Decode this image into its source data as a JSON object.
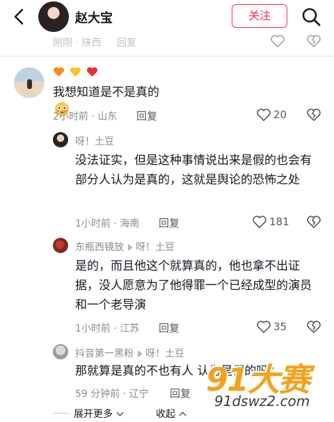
{
  "header": {
    "username": "赵大宝",
    "follow_label": "关注"
  },
  "faded_row": {
    "meta": "刚刚 · 陕西",
    "reply": "回复"
  },
  "comment1": {
    "text": "我想知道是不是真的",
    "emoji_hearts": [
      "orange-heart",
      "yellow-heart",
      "red-heart"
    ],
    "meta": "2小时前 · 山东",
    "reply": "回复",
    "likes": "20"
  },
  "reply1": {
    "username": "呀！土豆",
    "text": "没法证实，但是这种事情说出来是假的也会有部分人认为是真的，这就是舆论的恐怖之处",
    "meta": "1小时前 · 海南",
    "reply": "回复",
    "likes": "181"
  },
  "reply2": {
    "username": "东瓶西镜放",
    "reply_to": "呀！土豆",
    "text": "是的，而且他这个就算真的，他也拿不出证据，没人愿意为了他得罪一个已经成型的演员和一个老导演",
    "meta": "1小时前 · 江苏",
    "reply": "回复",
    "likes": "35"
  },
  "reply3": {
    "username": "抖音第一黑粉",
    "reply_to": "呀！土豆",
    "text": "那就算是真的不也有人 认为是假的吗？",
    "meta": "59 分钟前 · 辽宁",
    "reply": "回复"
  },
  "bottom": {
    "expand": "展开更多",
    "collapse": "收起"
  },
  "watermark": {
    "logo": "91大赛",
    "url": "91dswz2.com"
  },
  "colors": {
    "accent": "#fe2c55",
    "meta": "#8a8b91"
  }
}
